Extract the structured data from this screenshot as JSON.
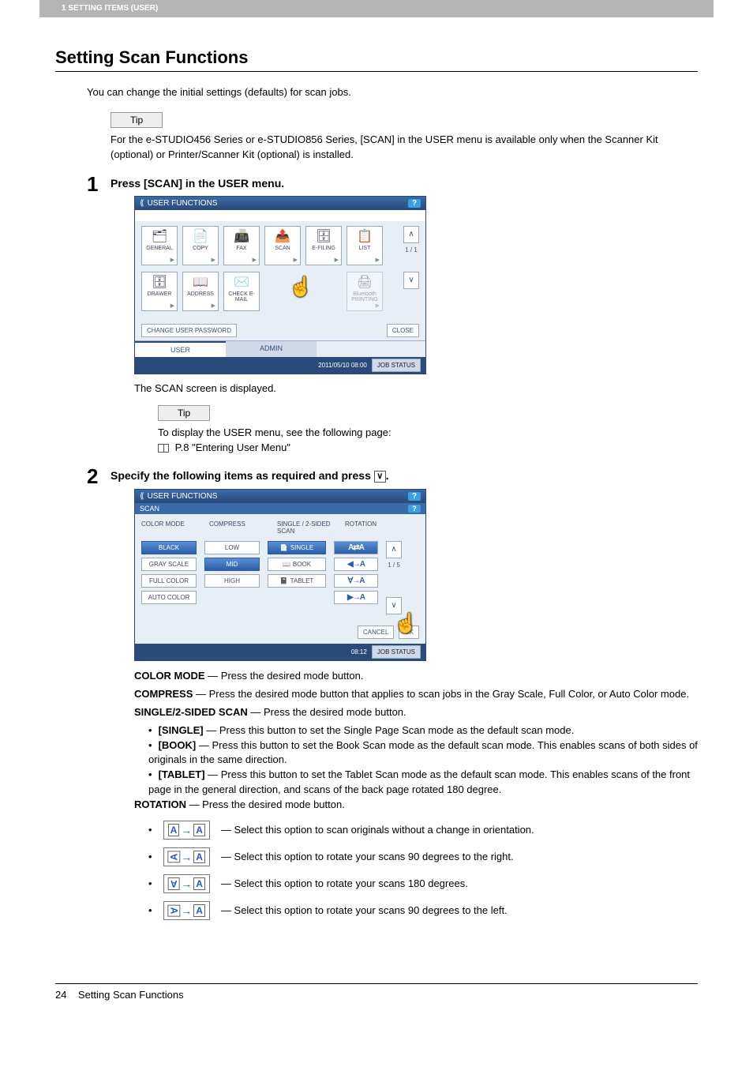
{
  "header": {
    "section_label": "1 SETTING ITEMS (USER)"
  },
  "title": "Setting Scan Functions",
  "intro": "You can change the initial settings (defaults) for scan jobs.",
  "tip1": {
    "label": "Tip",
    "text": "For the e-STUDIO456 Series or e-STUDIO856 Series, [SCAN] in the USER menu is available only when the Scanner Kit (optional) or Printer/Scanner Kit (optional) is installed."
  },
  "step1": {
    "num": "1",
    "title": "Press [SCAN] in the USER menu.",
    "after": "The SCAN screen is displayed."
  },
  "panel1": {
    "title": "USER FUNCTIONS",
    "help": "?",
    "icons_row1": [
      "GENERAL",
      "COPY",
      "FAX",
      "SCAN",
      "E-FILING",
      "LIST"
    ],
    "icons_row2": [
      "DRAWER",
      "ADDRESS",
      "CHECK E-MAIL",
      "",
      "",
      "Bluetooth PRINTING"
    ],
    "page": "1 / 1",
    "change_pw": "CHANGE USER PASSWORD",
    "close": "CLOSE",
    "tab_user": "USER",
    "tab_admin": "ADMIN",
    "datetime": "2011/05/10 08:00",
    "job_status": "JOB STATUS"
  },
  "tip2": {
    "label": "Tip",
    "line1": "To display the USER menu, see the following page:",
    "line2": "P.8 \"Entering User Menu\""
  },
  "step2": {
    "num": "2",
    "title_a": "Specify the following items as required and press ",
    "title_b": "."
  },
  "panel2": {
    "title": "USER FUNCTIONS",
    "crumb": "SCAN",
    "help": "?",
    "headers": [
      "COLOR MODE",
      "COMPRESS",
      "SINGLE / 2-SIDED SCAN",
      "ROTATION"
    ],
    "color_mode": [
      "BLACK",
      "GRAY SCALE",
      "FULL COLOR",
      "AUTO COLOR"
    ],
    "compress": [
      "LOW",
      "MID",
      "HIGH"
    ],
    "sided": [
      "SINGLE",
      "BOOK",
      "TABLET"
    ],
    "page": "1 / 5",
    "cancel": "CANCEL",
    "ok": "OK",
    "datetime": "08:12",
    "job_status": "JOB STATUS"
  },
  "desc": {
    "color_mode_t": "COLOR MODE",
    "color_mode": " — Press the desired mode button.",
    "compress_t": "COMPRESS",
    "compress": " — Press the desired mode button that applies to scan jobs in the Gray Scale, Full Color, or Auto Color mode.",
    "sided_t": "SINGLE/2-SIDED SCAN",
    "sided": " — Press the desired mode button.",
    "single_t": "[SINGLE]",
    "single": " — Press this button to set the Single Page Scan mode as the default scan mode.",
    "book_t": "[BOOK]",
    "book": " — Press this button to set the Book Scan mode as the default scan mode. This enables scans of both sides of originals in the same direction.",
    "tablet_t": "[TABLET]",
    "tablet": " — Press this button to set the Tablet Scan mode as the default scan mode. This enables scans of the front page in the general direction, and scans of the back page rotated 180 degree.",
    "rotation_t": "ROTATION",
    "rotation": " — Press the desired mode button.",
    "rot0": " — Select this option to scan originals without a change in orientation.",
    "rot90r": " — Select this option to rotate your scans 90 degrees to the right.",
    "rot180": " — Select this option to rotate your scans 180 degrees.",
    "rot90l": " — Select this option to rotate your scans 90 degrees to the left."
  },
  "footer": {
    "page": "24",
    "label": "Setting Scan Functions"
  }
}
